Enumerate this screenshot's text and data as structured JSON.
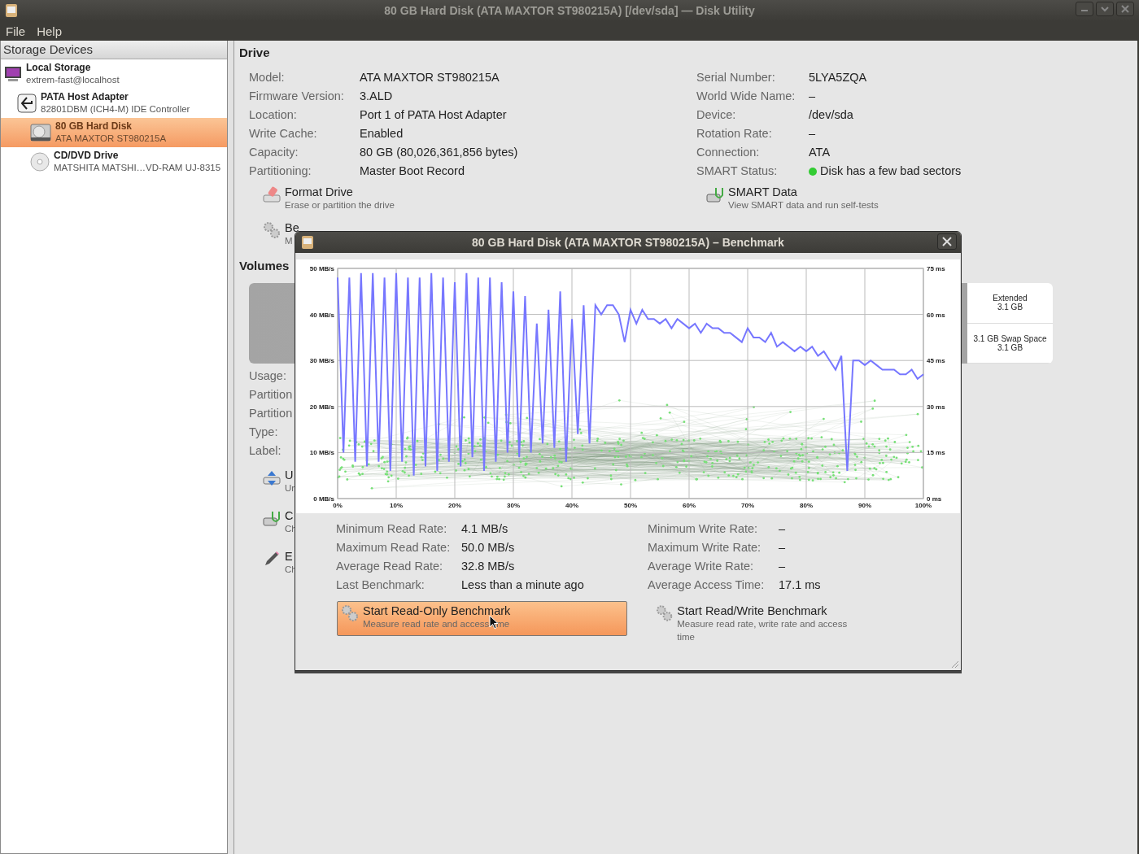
{
  "window": {
    "title": "80 GB Hard Disk (ATA MAXTOR ST980215A) [/dev/sda] — Disk Utility"
  },
  "menu": [
    "File",
    "Help"
  ],
  "sidebar": {
    "header": "Storage Devices",
    "items": [
      {
        "kind": "computer",
        "title": "Local Storage",
        "subtitle": "extrem-fast@localhost",
        "selected": false,
        "children": [
          {
            "kind": "adapter",
            "title": "PATA Host Adapter",
            "subtitle": "82801DBM (ICH4-M) IDE Controller",
            "selected": false,
            "children": [
              {
                "kind": "disk",
                "title": "80 GB Hard Disk",
                "subtitle": "ATA MAXTOR ST980215A",
                "selected": true
              },
              {
                "kind": "optical",
                "title": "CD/DVD Drive",
                "subtitle": "MATSHITA MATSHI…VD-RAM UJ-8315",
                "selected": false
              }
            ]
          }
        ]
      }
    ]
  },
  "drive": {
    "heading": "Drive",
    "left_fields": [
      {
        "label": "Model:",
        "value": "ATA MAXTOR ST980215A"
      },
      {
        "label": "Firmware Version:",
        "value": "3.ALD"
      },
      {
        "label": "Location:",
        "value": "Port 1 of PATA Host Adapter"
      },
      {
        "label": "Write Cache:",
        "value": "Enabled"
      },
      {
        "label": "Capacity:",
        "value": "80 GB (80,026,361,856 bytes)"
      },
      {
        "label": "Partitioning:",
        "value": "Master Boot Record"
      }
    ],
    "right_fields": [
      {
        "label": "Serial Number:",
        "value": "5LYA5ZQA"
      },
      {
        "label": "World Wide Name:",
        "value": "–"
      },
      {
        "label": "Device:",
        "value": "/dev/sda"
      },
      {
        "label": "Rotation Rate:",
        "value": "–"
      },
      {
        "label": "Connection:",
        "value": "ATA"
      },
      {
        "label": "SMART Status:",
        "value": "Disk has a few bad sectors",
        "color": "#33cc33"
      }
    ],
    "actions": [
      {
        "kind": "format",
        "title": "Format Drive",
        "subtitle": "Erase or partition the drive"
      },
      {
        "kind": "smart",
        "title": "SMART Data",
        "subtitle": "View SMART data and run self-tests"
      },
      {
        "kind": "benchmark",
        "title": "Be",
        "subtitle": "M"
      }
    ]
  },
  "volumes": {
    "heading": "Volumes",
    "cells": [
      {
        "title": "Extended",
        "size": "3.1 GB"
      },
      {
        "title": "3.1 GB Swap Space",
        "size": "3.1 GB"
      }
    ],
    "fields": [
      {
        "label": "Usage:"
      },
      {
        "label": "Partition"
      },
      {
        "label": "Partition"
      },
      {
        "label": "Type:"
      },
      {
        "label": "Label:"
      }
    ],
    "actions": [
      {
        "kind": "unmount",
        "title": "U",
        "subtitle": "Un"
      },
      {
        "kind": "smart",
        "title": "C",
        "subtitle": "Ch"
      },
      {
        "kind": "edit",
        "title": "E",
        "subtitle": "Ch"
      }
    ]
  },
  "dialog": {
    "title": "80 GB Hard Disk (ATA MAXTOR ST980215A) – Benchmark",
    "chart_data": {
      "type": "line",
      "grid": true,
      "xlim": [
        0,
        100
      ],
      "x": [
        0,
        1,
        2,
        3,
        4,
        5,
        6,
        7,
        8,
        9,
        10,
        11,
        12,
        13,
        14,
        15,
        16,
        17,
        18,
        19,
        20,
        21,
        22,
        23,
        24,
        25,
        26,
        27,
        28,
        29,
        30,
        31,
        32,
        33,
        34,
        35,
        36,
        37,
        38,
        39,
        40,
        41,
        42,
        43,
        44,
        45,
        46,
        47,
        48,
        49,
        50,
        51,
        52,
        53,
        54,
        55,
        56,
        57,
        58,
        59,
        60,
        61,
        62,
        63,
        64,
        65,
        66,
        67,
        68,
        69,
        70,
        71,
        72,
        73,
        74,
        75,
        76,
        77,
        78,
        79,
        80,
        81,
        82,
        83,
        84,
        85,
        86,
        87,
        88,
        89,
        90,
        91,
        92,
        93,
        94,
        95,
        96,
        97,
        98,
        99,
        100
      ],
      "ylim": [
        0,
        50
      ],
      "y2lim": [
        0,
        75
      ],
      "xticks": [
        {
          "value": 0,
          "label": "0%"
        },
        {
          "value": 10,
          "label": "10%"
        },
        {
          "value": 20,
          "label": "20%"
        },
        {
          "value": 30,
          "label": "30%"
        },
        {
          "value": 40,
          "label": "40%"
        },
        {
          "value": 50,
          "label": "50%"
        },
        {
          "value": 60,
          "label": "60%"
        },
        {
          "value": 70,
          "label": "70%"
        },
        {
          "value": 80,
          "label": "80%"
        },
        {
          "value": 90,
          "label": "90%"
        },
        {
          "value": 100,
          "label": "100%"
        }
      ],
      "yticks": [
        {
          "value": 0,
          "label": "0 MB/s"
        },
        {
          "value": 10,
          "label": "10 MB/s"
        },
        {
          "value": 20,
          "label": "20 MB/s"
        },
        {
          "value": 30,
          "label": "30 MB/s"
        },
        {
          "value": 40,
          "label": "40 MB/s"
        },
        {
          "value": 50,
          "label": "50 MB/s"
        }
      ],
      "y2ticks": [
        {
          "value": 0,
          "label": "0 ms"
        },
        {
          "value": 15,
          "label": "15 ms"
        },
        {
          "value": 30,
          "label": "30 ms"
        },
        {
          "value": 45,
          "label": "45 ms"
        },
        {
          "value": 60,
          "label": "60 ms"
        },
        {
          "value": 75,
          "label": "75 ms"
        }
      ],
      "series": [
        {
          "color": "#7777ff",
          "values": [
            48,
            10,
            48,
            8,
            49,
            7,
            49,
            8,
            48,
            6,
            49,
            8,
            48,
            5,
            48,
            7,
            49,
            6,
            48,
            8,
            47,
            7,
            49,
            9,
            48,
            6,
            48,
            8,
            47,
            10,
            45,
            9,
            44,
            10,
            38,
            12,
            41,
            11,
            45,
            8,
            39,
            14,
            42,
            12,
            42,
            40,
            42,
            42,
            40,
            34,
            41,
            38,
            41,
            39,
            39,
            38,
            39,
            37,
            39,
            38,
            37,
            38,
            36,
            38,
            37,
            37,
            36,
            36,
            35,
            34,
            37,
            35,
            35,
            34,
            36,
            33,
            34,
            33,
            32,
            33,
            32,
            33,
            31,
            32,
            30,
            28,
            31,
            6,
            30,
            30,
            29,
            30,
            29,
            28,
            28,
            28,
            27,
            27,
            28,
            26,
            27
          ]
        }
      ]
    },
    "stats_left": [
      {
        "label": "Minimum Read Rate:",
        "value": "4.1 MB/s"
      },
      {
        "label": "Maximum Read Rate:",
        "value": "50.0 MB/s"
      },
      {
        "label": "Average Read Rate:",
        "value": "32.8 MB/s"
      },
      {
        "label": "Last Benchmark:",
        "value": "Less than a minute ago"
      }
    ],
    "stats_right": [
      {
        "label": "Minimum Write Rate:",
        "value": "–"
      },
      {
        "label": "Maximum Write Rate:",
        "value": "–"
      },
      {
        "label": "Average Write Rate:",
        "value": "–"
      },
      {
        "label": "Average Access Time:",
        "value": "17.1 ms"
      }
    ],
    "buttons": [
      {
        "title": "Start Read-Only Benchmark",
        "subtitle": "Measure read rate and access time",
        "selected": true
      },
      {
        "title": "Start Read/Write Benchmark",
        "subtitle": "Measure read rate, write rate and access time",
        "selected": false
      }
    ]
  }
}
